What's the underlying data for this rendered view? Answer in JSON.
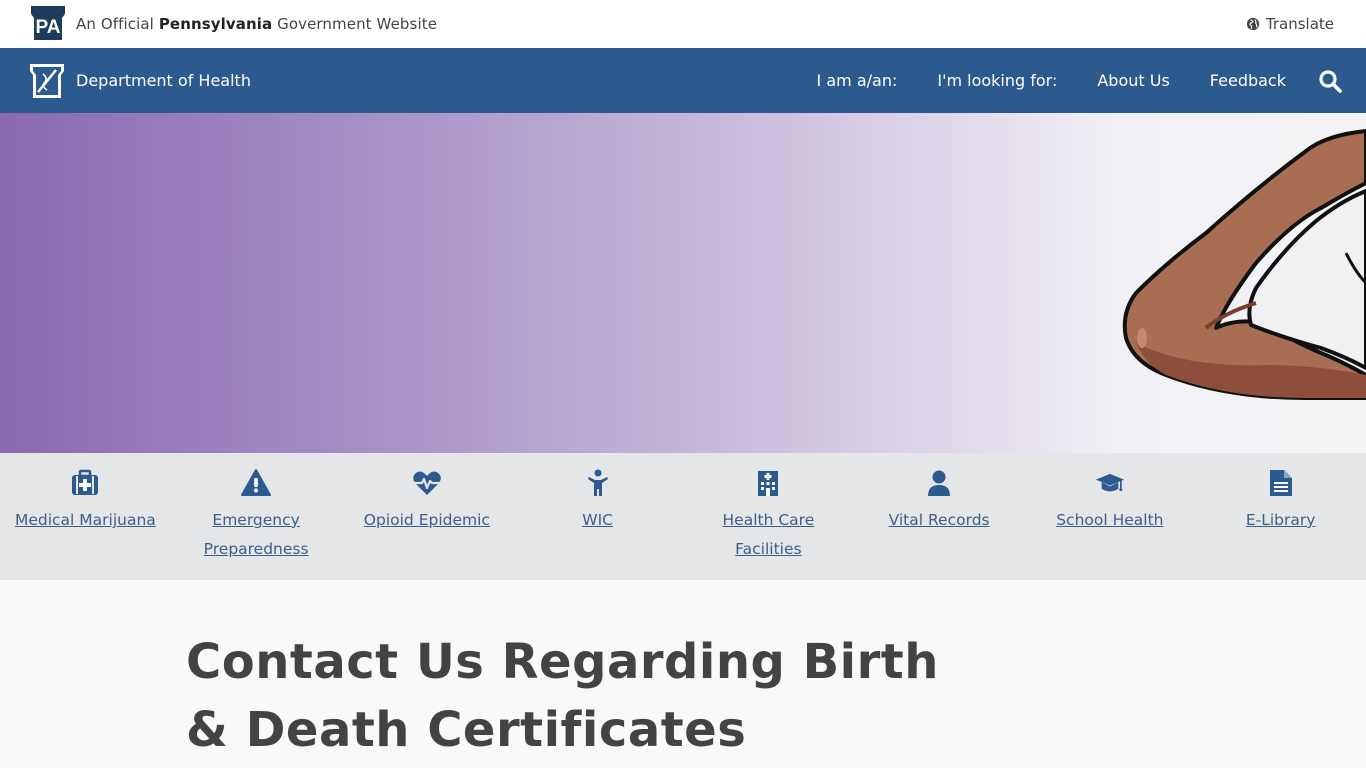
{
  "official_bar": {
    "badge": "PA",
    "prefix": "An Official ",
    "state": "Pennsylvania",
    "suffix": " Government Website",
    "translate_label": "Translate"
  },
  "dept_nav": {
    "dept_name": "Department of Health",
    "links": [
      "I am a/an:",
      "I'm looking for:",
      "About Us",
      "Feedback"
    ]
  },
  "quick_links": [
    {
      "label": "Medical Marijuana",
      "icon": "medical-kit-icon"
    },
    {
      "label": "Emergency Preparedness",
      "icon": "warning-icon"
    },
    {
      "label": "Opioid Epidemic",
      "icon": "heartbeat-icon"
    },
    {
      "label": "WIC",
      "icon": "child-icon"
    },
    {
      "label": "Health Care Facilities",
      "icon": "hospital-icon"
    },
    {
      "label": "Vital Records",
      "icon": "person-icon"
    },
    {
      "label": "School Health",
      "icon": "graduation-cap-icon"
    },
    {
      "label": "E-Library",
      "icon": "document-icon"
    }
  ],
  "main": {
    "title": "Contact Us Regarding Birth & Death Certificates"
  },
  "colors": {
    "nav_blue": "#2c5a8e",
    "link_blue": "#3c5f8a",
    "icon_blue": "#2c5a8e",
    "hero_purple": "#8a69b0"
  }
}
